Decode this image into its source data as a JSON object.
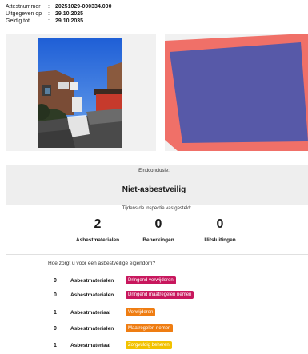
{
  "certificate": {
    "rows": [
      {
        "label": "Attestnummer",
        "sep": ":",
        "value": "20251029-000334.000"
      },
      {
        "label": "Uitgegeven op",
        "sep": ":",
        "value": "29.10.2025"
      },
      {
        "label": "Geldig tot",
        "sep": ":",
        "value": "29.10.2035"
      }
    ]
  },
  "conclusion": {
    "label": "Eindconclusie:",
    "value": "Niet-asbestveilig"
  },
  "inspection": {
    "label": "Tijdens de inspectie vastgesteld:",
    "stats": [
      {
        "value": "2",
        "label": "Asbestmaterialen"
      },
      {
        "value": "0",
        "label": "Beperkingen"
      },
      {
        "value": "0",
        "label": "Uitsluitingen"
      }
    ]
  },
  "actions": {
    "question": "Hoe zorgt u voor een asbestveilige eigendom?",
    "items": [
      {
        "count": "0",
        "material": "Asbestmaterialen",
        "badge": "Dringend verwijderen",
        "color": "#c8175d"
      },
      {
        "count": "0",
        "material": "Asbestmaterialen",
        "badge": "Dringend maatregelen nemen",
        "color": "#c8175d"
      },
      {
        "count": "1",
        "material": "Asbestmateriaal",
        "badge": "Verwijderen",
        "color": "#ef7d12"
      },
      {
        "count": "0",
        "material": "Asbestmaterialen",
        "badge": "Maatregelen nemen",
        "color": "#ef7d12"
      },
      {
        "count": "1",
        "material": "Asbestmateriaal",
        "badge": "Zorgvuldig beheren",
        "color": "#f2c200"
      }
    ]
  },
  "colors": {
    "roof_outer": "#f07068",
    "roof_inner": "#5759a8"
  }
}
